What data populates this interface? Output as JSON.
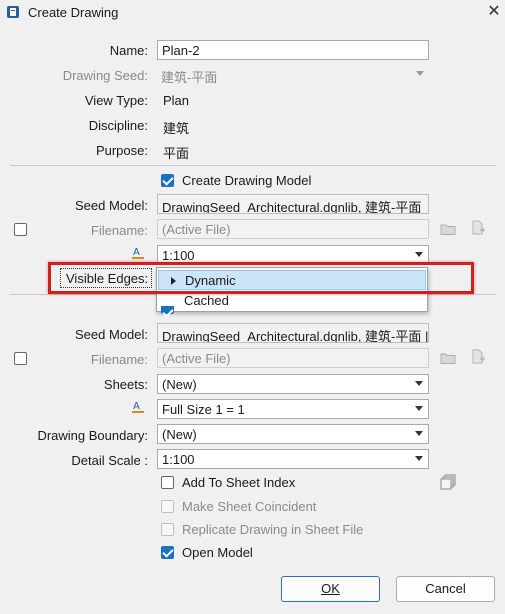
{
  "window": {
    "title": "Create Drawing",
    "close_glyph": "✕"
  },
  "form": {
    "name": {
      "label": "Name:",
      "value": "Plan-2"
    },
    "drawing_seed": {
      "label": "Drawing Seed:",
      "value": "建筑-平面"
    },
    "view_type": {
      "label": "View Type:",
      "value": "Plan"
    },
    "discipline": {
      "label": "Discipline:",
      "value": "建筑"
    },
    "purpose": {
      "label": "Purpose:",
      "value": "平面"
    }
  },
  "drawing_model": {
    "create_label": "Create Drawing Model",
    "create_checked": true,
    "seed_model": {
      "label": "Seed Model:",
      "value": "DrawingSeed_Architectural.dgnlib, 建筑-平面"
    },
    "filename": {
      "label": "Filename:",
      "value": "(Active File)"
    },
    "annotation_scale": {
      "value": "1:100"
    },
    "visible_edges": {
      "label": "Visible Edges:",
      "options": [
        "Dynamic",
        "Cached"
      ],
      "selected": "Dynamic"
    }
  },
  "sheet_model": {
    "seed_model": {
      "label": "Seed Model:",
      "value": "DrawingSeed_Architectural.dgnlib, 建筑-平面 |"
    },
    "filename": {
      "label": "Filename:",
      "value": "(Active File)"
    },
    "sheets": {
      "label": "Sheets:",
      "value": "(New)"
    },
    "sheet_size": {
      "value": "Full Size 1 = 1"
    },
    "drawing_boundary": {
      "label": "Drawing Boundary:",
      "value": "(New)"
    },
    "detail_scale": {
      "label": "Detail Scale :",
      "value": "1:100"
    },
    "add_to_sheet_index": {
      "label": "Add To Sheet Index",
      "checked": false
    },
    "make_sheet_coincident": {
      "label": "Make Sheet Coincident",
      "checked": false
    },
    "replicate_drawing": {
      "label": "Replicate Drawing in Sheet File",
      "checked": false
    },
    "open_model": {
      "label": "Open Model",
      "checked": true
    }
  },
  "buttons": {
    "ok": "OK",
    "cancel": "Cancel"
  },
  "colors": {
    "accent": "#1a6fc9",
    "highlight": "#d21e1e",
    "selected_bg": "#cce4f7"
  }
}
